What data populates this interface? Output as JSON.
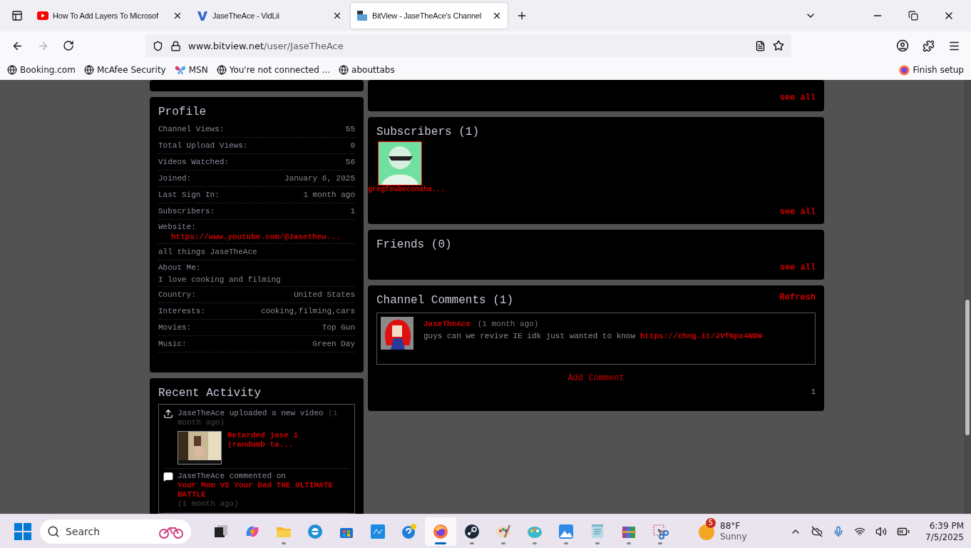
{
  "browser": {
    "tabs": [
      {
        "title": "How To Add Layers To Microsof",
        "selected": false
      },
      {
        "title": "JaseTheAce - VidLii",
        "selected": false
      },
      {
        "title": "BitView - JaseTheAce's Channel",
        "selected": true
      }
    ],
    "address": {
      "host": "www.bitview.net",
      "path": "/user/JaseTheAce"
    },
    "bookmarks": [
      "Booking.com",
      "McAfee Security",
      "MSN",
      "You're not connected ...",
      "abouttabs"
    ],
    "finish_setup": "Finish setup"
  },
  "top_panel": {
    "see_all": "see all"
  },
  "profile": {
    "title": "Profile",
    "rows": [
      {
        "kind": "pair",
        "label": "Channel Views:",
        "value": "55"
      },
      {
        "kind": "pair",
        "label": "Total Upload Views:",
        "value": "0"
      },
      {
        "kind": "pair",
        "label": "Videos Watched:",
        "value": "56"
      },
      {
        "kind": "pair",
        "label": "Joined:",
        "value": "January 6, 2025"
      },
      {
        "kind": "pair",
        "label": "Last Sign In:",
        "value": "1 month ago"
      },
      {
        "kind": "pair",
        "label": "Subscribers:",
        "value": "1"
      },
      {
        "kind": "link",
        "label": "Website:",
        "value": "https://www.youtube.com/@Jasethew..."
      },
      {
        "kind": "text",
        "value": "all things JaseTheAce"
      },
      {
        "kind": "block",
        "label": "About Me:",
        "value": "I love cooking and filming"
      },
      {
        "kind": "pair",
        "label": "Country:",
        "value": "United States"
      },
      {
        "kind": "pair",
        "label": "Interests:",
        "value": "cooking,filming,cars"
      },
      {
        "kind": "pair",
        "label": "Movies:",
        "value": "Top Gun"
      },
      {
        "kind": "pair",
        "label": "Music:",
        "value": "Green Day"
      }
    ]
  },
  "recent_activity": {
    "title": "Recent Activity",
    "items": [
      {
        "kind": "upload",
        "user": "JaseTheAce",
        "action": "uploaded a new video",
        "time": "(1 month ago)",
        "video_title": "Retarded jase 1 (randumb ta..."
      },
      {
        "kind": "comment",
        "user": "JaseTheAce",
        "action": "commented on",
        "target": "Your Mom VS Your Dad THE ULTIMATE BATTLE",
        "time": "(1 month ago)"
      }
    ]
  },
  "subscribers": {
    "title": "Subscribers (1)",
    "users": [
      {
        "name": "gregfewbeconaha..."
      }
    ],
    "see_all": "see all"
  },
  "friends": {
    "title": "Friends (0)",
    "see_all": "see all"
  },
  "comments": {
    "title": "Channel Comments (1)",
    "refresh": "Refresh",
    "items": [
      {
        "author": "JaseTheAce",
        "time": "(1 month ago)",
        "text": "guys can we revive IE idk just wanted to know",
        "link": "https://chng.it/JVfNpx4NDW"
      }
    ],
    "add": "Add Comment",
    "page": "1"
  },
  "taskbar": {
    "search_placeholder": "Search",
    "apps": [
      {
        "kind": "taskview",
        "running": false,
        "active": false
      },
      {
        "kind": "copilot",
        "running": false,
        "active": false
      },
      {
        "kind": "files",
        "running": true,
        "active": false
      },
      {
        "kind": "edge",
        "running": false,
        "active": false
      },
      {
        "kind": "store",
        "running": false,
        "active": false
      },
      {
        "kind": "hp",
        "running": false,
        "active": false
      },
      {
        "kind": "help",
        "running": false,
        "active": false
      },
      {
        "kind": "firefox",
        "running": true,
        "active": true
      },
      {
        "kind": "steam",
        "running": true,
        "active": false
      },
      {
        "kind": "paint",
        "running": true,
        "active": false
      },
      {
        "kind": "paint3d",
        "running": true,
        "active": false
      },
      {
        "kind": "photos",
        "running": true,
        "active": false
      },
      {
        "kind": "notepad",
        "running": true,
        "active": false
      },
      {
        "kind": "archive",
        "running": true,
        "active": false
      },
      {
        "kind": "snip",
        "running": true,
        "active": false
      }
    ],
    "weather": {
      "badge": "5",
      "temp": "88°F",
      "condition": "Sunny"
    },
    "clock": {
      "time": "6:39 PM",
      "date": "7/5/2025"
    }
  }
}
